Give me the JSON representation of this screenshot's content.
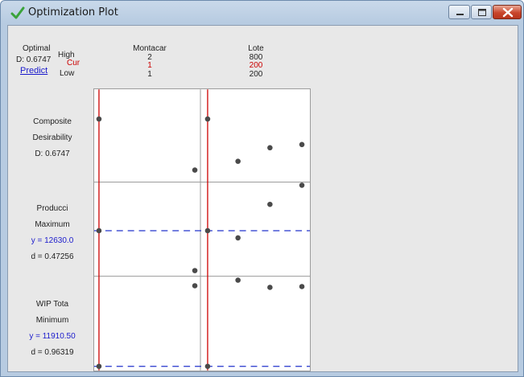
{
  "window": {
    "title": "Optimization Plot",
    "icon": "checkmark-icon",
    "buttons": [
      "minimize-icon",
      "maximize-icon",
      "close-icon"
    ]
  },
  "header": {
    "optimal_label": "Optimal",
    "d_label": "D: 0.6747",
    "predict_link": "Predict",
    "high_label": "High",
    "cur_label": "Cur",
    "low_label": "Low"
  },
  "factors": [
    {
      "name": "Montacar",
      "high": "2",
      "cur": "1",
      "low": "1"
    },
    {
      "name": "Lote",
      "high": "800",
      "cur": "200",
      "low": "200"
    }
  ],
  "responses": [
    {
      "name": "Composite",
      "line2": "Desirability",
      "line3": "D: 0.6747",
      "line4": ""
    },
    {
      "name": "Producci",
      "line2": "Maximum",
      "line3": "y = 12630.0",
      "line4": "d = 0.47256"
    },
    {
      "name": "WIP Tota",
      "line2": "Minimum",
      "line3": "y = 11910.50",
      "line4": "d = 0.96319"
    }
  ],
  "colors": {
    "current_line": "#cc0000",
    "target_line": "#2233cc",
    "points": "#4a4a4a",
    "grid": "#9c9c9c"
  }
}
